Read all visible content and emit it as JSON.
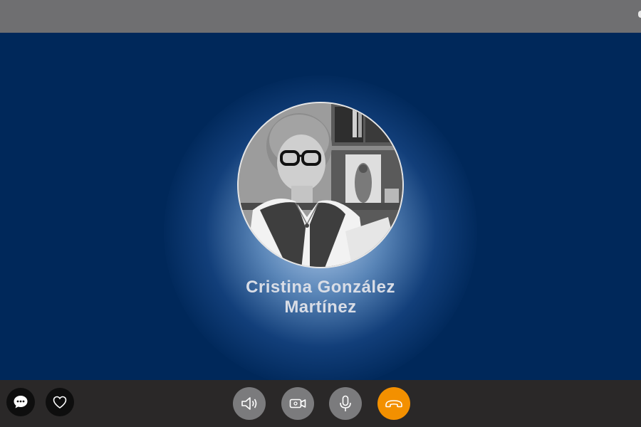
{
  "caller": {
    "name_line1": "Cristina González",
    "name_line2": "Martínez",
    "avatar_alt": "Cristina González Martínez"
  },
  "controls": {
    "left": [
      {
        "icon": "chat-bubble-icon"
      },
      {
        "icon": "heart-icon"
      }
    ],
    "center": [
      {
        "icon": "speaker-icon"
      },
      {
        "icon": "video-camera-icon"
      },
      {
        "icon": "microphone-icon"
      },
      {
        "icon": "hang-up-icon"
      }
    ]
  },
  "colors": {
    "top_bar": "#6f6f71",
    "stage_background": "#00285a",
    "bottom_bar": "#2a2828",
    "control_button": "#7b7b7d",
    "end_call": "#f39000",
    "name_text": "#d9dde6"
  }
}
